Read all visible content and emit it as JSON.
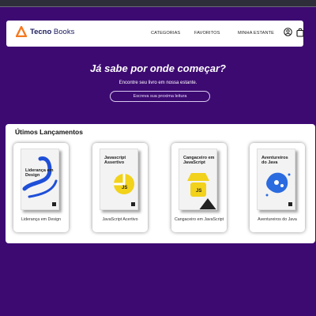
{
  "header": {
    "brand_bold": "Tecno",
    "brand_light": "Books",
    "nav": [
      {
        "label": "CATEGORIAS"
      },
      {
        "label": "FAVORITOS"
      },
      {
        "label": "MINHA ESTANTE"
      }
    ],
    "icons": [
      "user-icon",
      "shopping-bag-icon"
    ],
    "accent": "#f47a20"
  },
  "hero": {
    "title": "Já sabe por onde começar?",
    "subtitle": "Encontre seu livro em nossa estante.",
    "search_placeholder": "Escreva sua proxima leitura"
  },
  "releases": {
    "title": "Útimos Lançamentos",
    "books": [
      {
        "label": "Liderança em Design",
        "cover_title": "Liderança em Design",
        "cover_color": "#1f4fd8"
      },
      {
        "label": "JavaScript Acertivo",
        "cover_title": "Javascript Assertivo",
        "cover_color": "#f2d21b"
      },
      {
        "label": "Cangaceiro em JavaScript",
        "cover_title": "Cangaceiro em JavaScript",
        "cover_color": "#f2d21b"
      },
      {
        "label": "Aventureiros do Java",
        "cover_title": "Aventureiros do Java",
        "cover_color": "#2b6be0"
      }
    ]
  },
  "colors": {
    "page_background": "#3d0a72",
    "panel": "#ffffff",
    "brand_text": "#1b1b5e"
  }
}
